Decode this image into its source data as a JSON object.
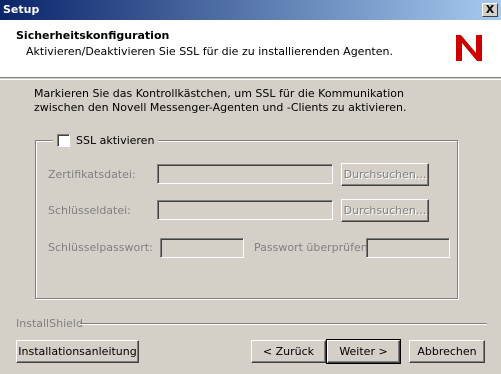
{
  "window": {
    "title": "Setup",
    "close_label": "X"
  },
  "header": {
    "title": "Sicherheitskonfiguration",
    "subtitle": "Aktivieren/Deaktivieren Sie SSL für die zu installierenden Agenten.",
    "logo_letter": "N",
    "logo_color": "#cc0000"
  },
  "intro_text": "Markieren Sie das Kontrollkästchen, um SSL für die Kommunikation zwischen den Novell Messenger-Agenten und -Clients zu aktivieren.",
  "ssl": {
    "checkbox_label": "SSL aktivieren",
    "checked": false,
    "certificate_label": "Zertifikatsdatei:",
    "certificate_value": "",
    "key_label": "Schlüsseldatei:",
    "key_value": "",
    "password_label": "Schlüsselpasswort:",
    "password_value": "",
    "verify_label": "Passwort überprüfen:",
    "verify_value": "",
    "browse_label": "Durchsuchen..."
  },
  "footer": {
    "brand": "InstallShield",
    "guide_label": "Installationsanleitung",
    "back_label": "< Zurück",
    "next_label": "Weiter >",
    "cancel_label": "Abbrechen"
  }
}
